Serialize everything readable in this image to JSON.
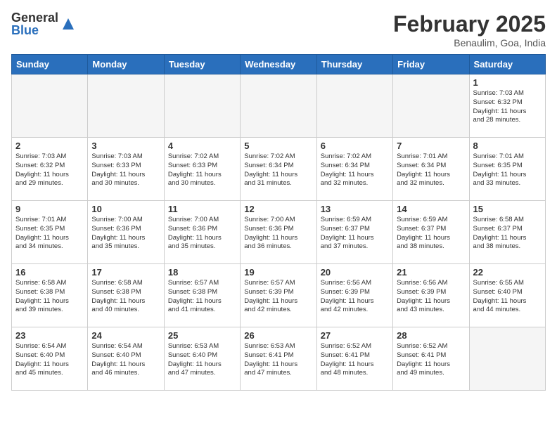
{
  "logo": {
    "general": "General",
    "blue": "Blue"
  },
  "header": {
    "month": "February 2025",
    "location": "Benaulim, Goa, India"
  },
  "days_of_week": [
    "Sunday",
    "Monday",
    "Tuesday",
    "Wednesday",
    "Thursday",
    "Friday",
    "Saturday"
  ],
  "weeks": [
    [
      {
        "day": "",
        "info": ""
      },
      {
        "day": "",
        "info": ""
      },
      {
        "day": "",
        "info": ""
      },
      {
        "day": "",
        "info": ""
      },
      {
        "day": "",
        "info": ""
      },
      {
        "day": "",
        "info": ""
      },
      {
        "day": "1",
        "info": "Sunrise: 7:03 AM\nSunset: 6:32 PM\nDaylight: 11 hours\nand 28 minutes."
      }
    ],
    [
      {
        "day": "2",
        "info": "Sunrise: 7:03 AM\nSunset: 6:32 PM\nDaylight: 11 hours\nand 29 minutes."
      },
      {
        "day": "3",
        "info": "Sunrise: 7:03 AM\nSunset: 6:33 PM\nDaylight: 11 hours\nand 30 minutes."
      },
      {
        "day": "4",
        "info": "Sunrise: 7:02 AM\nSunset: 6:33 PM\nDaylight: 11 hours\nand 30 minutes."
      },
      {
        "day": "5",
        "info": "Sunrise: 7:02 AM\nSunset: 6:34 PM\nDaylight: 11 hours\nand 31 minutes."
      },
      {
        "day": "6",
        "info": "Sunrise: 7:02 AM\nSunset: 6:34 PM\nDaylight: 11 hours\nand 32 minutes."
      },
      {
        "day": "7",
        "info": "Sunrise: 7:01 AM\nSunset: 6:34 PM\nDaylight: 11 hours\nand 32 minutes."
      },
      {
        "day": "8",
        "info": "Sunrise: 7:01 AM\nSunset: 6:35 PM\nDaylight: 11 hours\nand 33 minutes."
      }
    ],
    [
      {
        "day": "9",
        "info": "Sunrise: 7:01 AM\nSunset: 6:35 PM\nDaylight: 11 hours\nand 34 minutes."
      },
      {
        "day": "10",
        "info": "Sunrise: 7:00 AM\nSunset: 6:36 PM\nDaylight: 11 hours\nand 35 minutes."
      },
      {
        "day": "11",
        "info": "Sunrise: 7:00 AM\nSunset: 6:36 PM\nDaylight: 11 hours\nand 35 minutes."
      },
      {
        "day": "12",
        "info": "Sunrise: 7:00 AM\nSunset: 6:36 PM\nDaylight: 11 hours\nand 36 minutes."
      },
      {
        "day": "13",
        "info": "Sunrise: 6:59 AM\nSunset: 6:37 PM\nDaylight: 11 hours\nand 37 minutes."
      },
      {
        "day": "14",
        "info": "Sunrise: 6:59 AM\nSunset: 6:37 PM\nDaylight: 11 hours\nand 38 minutes."
      },
      {
        "day": "15",
        "info": "Sunrise: 6:58 AM\nSunset: 6:37 PM\nDaylight: 11 hours\nand 38 minutes."
      }
    ],
    [
      {
        "day": "16",
        "info": "Sunrise: 6:58 AM\nSunset: 6:38 PM\nDaylight: 11 hours\nand 39 minutes."
      },
      {
        "day": "17",
        "info": "Sunrise: 6:58 AM\nSunset: 6:38 PM\nDaylight: 11 hours\nand 40 minutes."
      },
      {
        "day": "18",
        "info": "Sunrise: 6:57 AM\nSunset: 6:38 PM\nDaylight: 11 hours\nand 41 minutes."
      },
      {
        "day": "19",
        "info": "Sunrise: 6:57 AM\nSunset: 6:39 PM\nDaylight: 11 hours\nand 42 minutes."
      },
      {
        "day": "20",
        "info": "Sunrise: 6:56 AM\nSunset: 6:39 PM\nDaylight: 11 hours\nand 42 minutes."
      },
      {
        "day": "21",
        "info": "Sunrise: 6:56 AM\nSunset: 6:39 PM\nDaylight: 11 hours\nand 43 minutes."
      },
      {
        "day": "22",
        "info": "Sunrise: 6:55 AM\nSunset: 6:40 PM\nDaylight: 11 hours\nand 44 minutes."
      }
    ],
    [
      {
        "day": "23",
        "info": "Sunrise: 6:54 AM\nSunset: 6:40 PM\nDaylight: 11 hours\nand 45 minutes."
      },
      {
        "day": "24",
        "info": "Sunrise: 6:54 AM\nSunset: 6:40 PM\nDaylight: 11 hours\nand 46 minutes."
      },
      {
        "day": "25",
        "info": "Sunrise: 6:53 AM\nSunset: 6:40 PM\nDaylight: 11 hours\nand 47 minutes."
      },
      {
        "day": "26",
        "info": "Sunrise: 6:53 AM\nSunset: 6:41 PM\nDaylight: 11 hours\nand 47 minutes."
      },
      {
        "day": "27",
        "info": "Sunrise: 6:52 AM\nSunset: 6:41 PM\nDaylight: 11 hours\nand 48 minutes."
      },
      {
        "day": "28",
        "info": "Sunrise: 6:52 AM\nSunset: 6:41 PM\nDaylight: 11 hours\nand 49 minutes."
      },
      {
        "day": "",
        "info": ""
      }
    ]
  ]
}
